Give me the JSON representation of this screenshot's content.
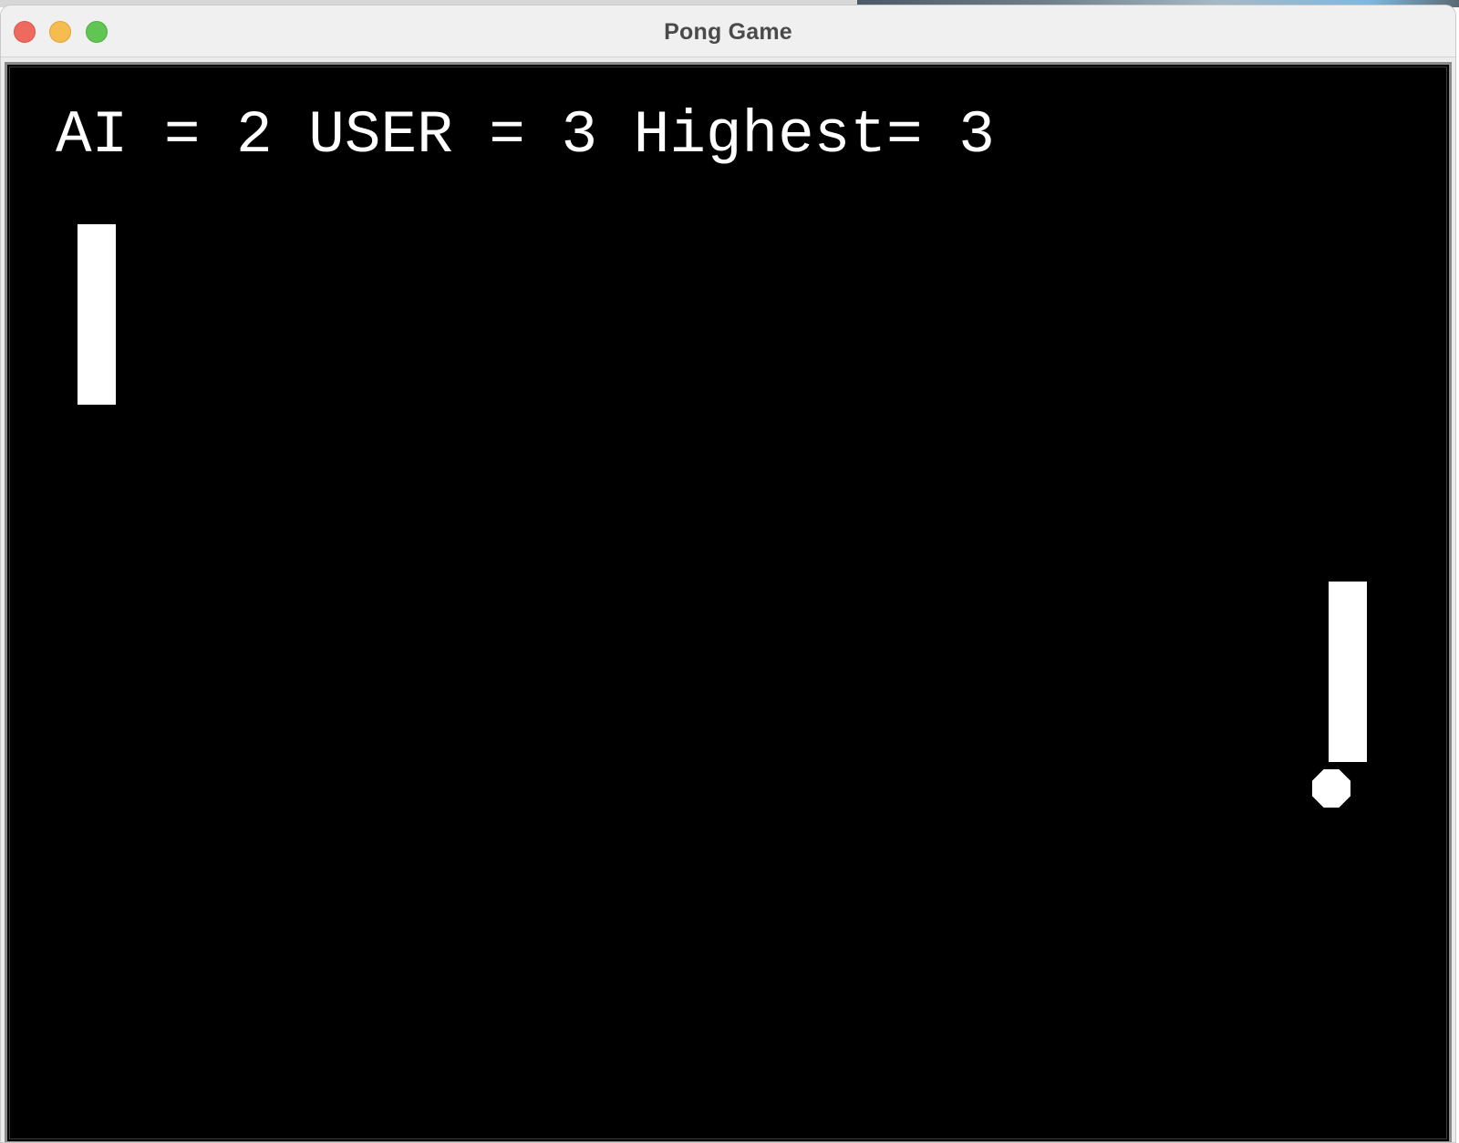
{
  "window": {
    "title": "Pong Game"
  },
  "scoreboard": {
    "ai_label": "AI =",
    "ai_score": "2",
    "user_label": "USER =",
    "user_score": "3",
    "highest_label": "Highest=",
    "highest_score": "3"
  },
  "colors": {
    "background": "#000000",
    "foreground": "#ffffff",
    "close_button": "#ee6a5f",
    "minimize_button": "#f5bd4f",
    "maximize_button": "#61c554"
  },
  "icons": {
    "close": "close-icon",
    "minimize": "minimize-icon",
    "maximize": "maximize-icon"
  }
}
